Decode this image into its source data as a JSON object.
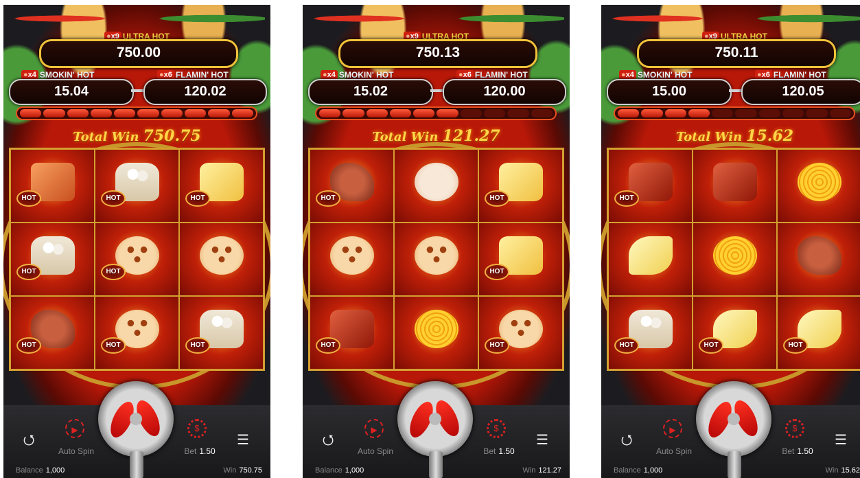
{
  "labels": {
    "ultra_hot": "ULTRA HOT",
    "smokin_hot": "SMOKIN' HOT",
    "flamin_hot": "FLAMIN' HOT",
    "x9": "x9",
    "x4": "x4",
    "x6": "x6",
    "total_win": "Total Win",
    "hot": "HOT",
    "auto_spin": "Auto Spin",
    "bet": "Bet",
    "balance": "Balance",
    "win": "Win"
  },
  "panels": [
    {
      "ultra": "750.00",
      "smokin": "15.04",
      "flamin": "120.02",
      "total_win": "750.75",
      "meter_on": 10,
      "bet": "1.50",
      "balance": "1,000",
      "win": "750.75",
      "grid": [
        {
          "food": "tofu",
          "hot": true
        },
        {
          "food": "mush",
          "hot": true
        },
        {
          "food": "potato",
          "hot": true
        },
        {
          "food": "mush",
          "hot": true
        },
        {
          "food": "lotus",
          "hot": true
        },
        {
          "food": "lotus",
          "hot": false
        },
        {
          "food": "tripe",
          "hot": true
        },
        {
          "food": "lotus",
          "hot": true
        },
        {
          "food": "mush",
          "hot": true
        }
      ]
    },
    {
      "ultra": "750.13",
      "smokin": "15.02",
      "flamin": "120.00",
      "total_win": "121.27",
      "meter_on": 6,
      "bet": "1.50",
      "balance": "1,000",
      "win": "121.27",
      "grid": [
        {
          "food": "tripe",
          "hot": true
        },
        {
          "food": "fishball",
          "hot": false
        },
        {
          "food": "potato",
          "hot": true
        },
        {
          "food": "lotus",
          "hot": false
        },
        {
          "food": "lotus",
          "hot": false
        },
        {
          "food": "potato",
          "hot": true
        },
        {
          "food": "beef",
          "hot": true
        },
        {
          "food": "corn",
          "hot": false
        },
        {
          "food": "lotus",
          "hot": true
        }
      ]
    },
    {
      "ultra": "750.11",
      "smokin": "15.00",
      "flamin": "120.05",
      "total_win": "15.62",
      "meter_on": 4,
      "bet": "1.50",
      "balance": "1,000",
      "win": "15.62",
      "grid": [
        {
          "food": "beef",
          "hot": true
        },
        {
          "food": "beef",
          "hot": false
        },
        {
          "food": "corn",
          "hot": false
        },
        {
          "food": "banana",
          "hot": false
        },
        {
          "food": "corn",
          "hot": false
        },
        {
          "food": "tripe",
          "hot": false
        },
        {
          "food": "mush",
          "hot": true
        },
        {
          "food": "banana",
          "hot": true
        },
        {
          "food": "banana",
          "hot": true
        }
      ]
    }
  ]
}
